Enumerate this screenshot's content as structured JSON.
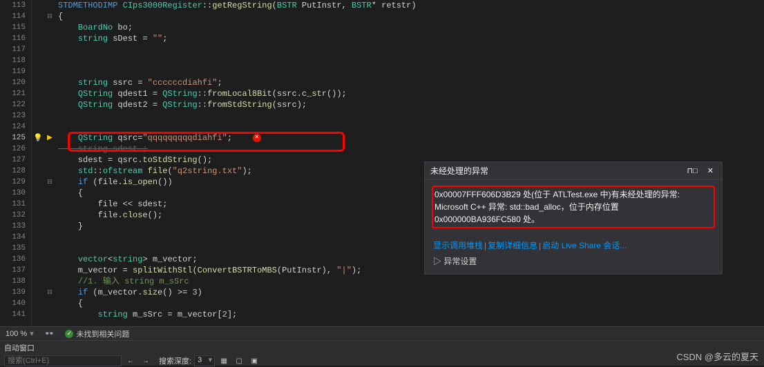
{
  "gutter": {
    "lines": [
      113,
      114,
      115,
      116,
      117,
      118,
      119,
      120,
      121,
      122,
      123,
      124,
      125,
      126,
      127,
      128,
      129,
      130,
      131,
      132,
      133,
      134,
      135,
      136,
      137,
      138,
      139,
      140,
      141
    ],
    "active": 125
  },
  "fold": {
    "114": "⊟",
    "125_glyph": "⊞",
    "129": "⊟",
    "130": "|",
    "131": "|",
    "132": "|",
    "133": "|",
    "139": "⊟"
  },
  "code": {
    "l113": "STDMETHODIMP CIps3000Register::getRegString(BSTR PutInstr, BSTR* retstr)",
    "l114": "{",
    "l115": "    BoardNo bo;",
    "l116": "    string sDest = \"\";",
    "l117": "",
    "l118": "",
    "l119": "",
    "l120": "    string ssrc = \"ccccccdiahfi\";",
    "l121": "    QString qdest1 = QString::fromLocal8Bit(ssrc.c_str());",
    "l122": "    QString qdest2 = QString::fromStdString(ssrc);",
    "l123": "",
    "l124": "",
    "l125": "    QString qsrc=\"qqqqqqqqqdiahfi\";",
    "l126": "    string sdest ;",
    "l127": "    sdest = qsrc.toStdString();",
    "l128": "    std::ofstream file(\"q2string.txt\");",
    "l129": "    if (file.is_open())",
    "l130": "    {",
    "l131": "        file << sdest;",
    "l132": "        file.close();",
    "l133": "    }",
    "l134": "",
    "l135": "",
    "l136": "    vector<string> m_vector;",
    "l137": "    m_vector = splitWithStl(ConvertBSTRToMBS(PutInstr), \"|\");",
    "l138": "    //1. 输入 string m_sSrc",
    "l139": "    if (m_vector.size() >= 3)",
    "l140": "    {",
    "l141": "        string m_sSrc = m_vector[2];"
  },
  "dialog": {
    "title": "未经处理的异常",
    "body_line1": "0x00007FFF606D3B29 处(位于 ATLTest.exe 中)有未经处理的异常:",
    "body_line2": "Microsoft C++ 异常: std::bad_alloc，位于内存位置",
    "body_line3": "0x000000BA936FC580 处。",
    "link1": "显示调用堆栈",
    "link2": "复制详细信息",
    "link3": "启动 Live Share 会话...",
    "settings": "异常设置",
    "pin_icon": "pin",
    "close_icon": "close"
  },
  "status": {
    "zoom": "100 %",
    "no_issues": "未找到相关问题"
  },
  "auto": {
    "title": "自动窗口",
    "search_placeholder": "搜索(Ctrl+E)",
    "depth_label": "搜索深度:",
    "depth_value": "3"
  },
  "watermark": "CSDN @多云的夏天"
}
